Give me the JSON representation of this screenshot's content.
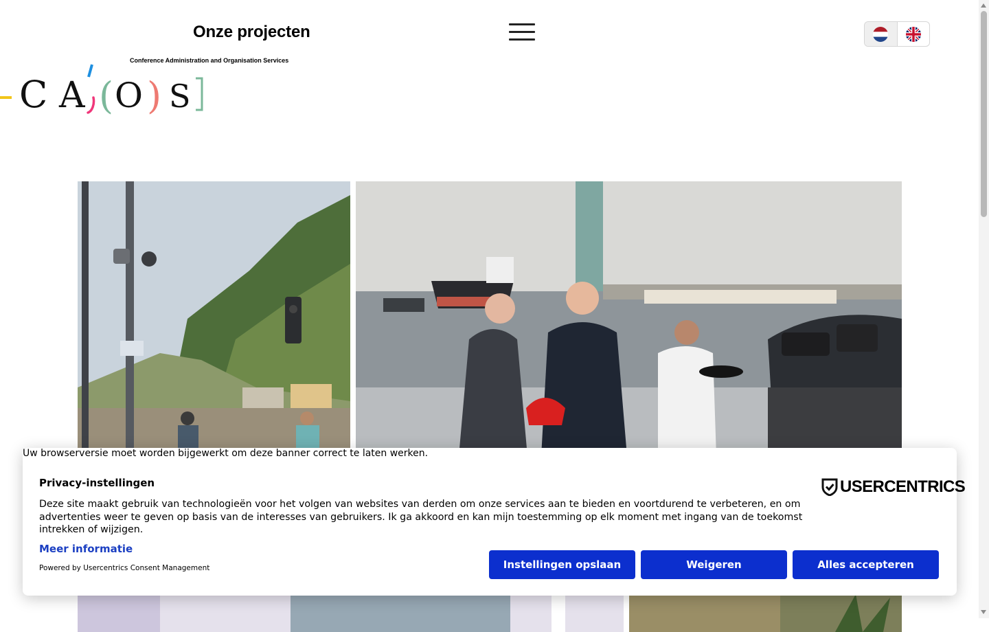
{
  "header": {
    "title": "Onze projecten",
    "menu_icon": "hamburger-menu-icon",
    "languages": [
      {
        "code": "nl",
        "icon": "dutch-flag-icon",
        "active": true
      },
      {
        "code": "en",
        "icon": "uk-flag-icon",
        "active": false
      }
    ]
  },
  "logo": {
    "subtitle": "Conference Administration and Organisation Services",
    "letters": [
      "C",
      "A",
      "(",
      "O",
      ")",
      "S"
    ],
    "colors": {
      "yellow": "#f2c51a",
      "blue": "#1e8fe0",
      "pink": "#f0377a",
      "green": "#7bb89a",
      "salmon": "#ee7a72"
    }
  },
  "gallery": [
    {
      "id": "photo-1",
      "subject": "mountain-train-station"
    },
    {
      "id": "photo-2",
      "subject": "harbour-ceremony"
    },
    {
      "id": "photo-3",
      "subject": "conference-hall"
    },
    {
      "id": "photo-4",
      "subject": "lobby-with-plants"
    }
  ],
  "consent": {
    "browser_warning": "Uw browserversie moet worden bijgewerkt om deze banner correct te laten werken.",
    "title": "Privacy-instellingen",
    "body": "Deze site maakt gebruik van technologieën voor het volgen van websites van derden om onze services aan te bieden en voortdurend te verbeteren, en om advertenties weer te geven op basis van de interesses van gebruikers. Ik ga akkoord en kan mijn toestemming op elk moment met ingang van de toekomst intrekken of wijzigen.",
    "more_link": "Meer informatie",
    "powered_by": "Powered by Usercentrics Consent Management",
    "brand": "USERCENTRICS",
    "buttons": {
      "save": "Instellingen opslaan",
      "deny": "Weigeren",
      "accept": "Alles accepteren"
    },
    "button_color": "#0c2fce"
  }
}
